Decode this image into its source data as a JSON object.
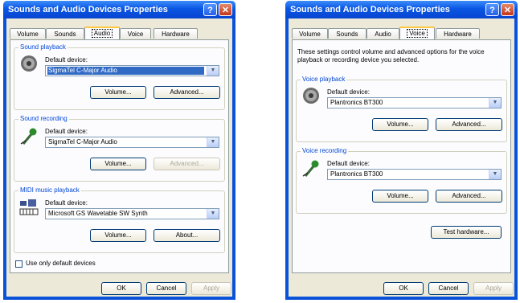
{
  "left_window": {
    "title": "Sounds and Audio Devices Properties",
    "help_glyph": "?",
    "close_glyph": "✕",
    "tabs": [
      {
        "label": "Volume"
      },
      {
        "label": "Sounds"
      },
      {
        "label": "Audio",
        "active": true
      },
      {
        "label": "Voice"
      },
      {
        "label": "Hardware"
      }
    ],
    "sound_playback": {
      "group_label": "Sound playback",
      "default_device_label": "Default device:",
      "device": "SigmaTel C-Major Audio",
      "volume_button": "Volume...",
      "advanced_button": "Advanced..."
    },
    "sound_recording": {
      "group_label": "Sound recording",
      "default_device_label": "Default device:",
      "device": "SigmaTel C-Major Audio",
      "volume_button": "Volume...",
      "advanced_button": "Advanced..."
    },
    "midi_playback": {
      "group_label": "MIDI music playback",
      "default_device_label": "Default device:",
      "device": "Microsoft GS Wavetable SW Synth",
      "volume_button": "Volume...",
      "about_button": "About..."
    },
    "use_default_checkbox": "Use only default devices",
    "ok_button": "OK",
    "cancel_button": "Cancel",
    "apply_button": "Apply"
  },
  "right_window": {
    "title": "Sounds and Audio Devices Properties",
    "help_glyph": "?",
    "close_glyph": "✕",
    "tabs": [
      {
        "label": "Volume"
      },
      {
        "label": "Sounds"
      },
      {
        "label": "Audio"
      },
      {
        "label": "Voice",
        "active": true
      },
      {
        "label": "Hardware"
      }
    ],
    "description": "These settings control volume and advanced options for the voice playback or recording device you selected.",
    "voice_playback": {
      "group_label": "Voice playback",
      "default_device_label": "Default device:",
      "device": "Plantronics BT300",
      "volume_button": "Volume...",
      "advanced_button": "Advanced..."
    },
    "voice_recording": {
      "group_label": "Voice recording",
      "default_device_label": "Default device:",
      "device": "Plantronics BT300",
      "volume_button": "Volume...",
      "advanced_button": "Advanced..."
    },
    "test_hardware_button": "Test hardware...",
    "ok_button": "OK",
    "cancel_button": "Cancel",
    "apply_button": "Apply"
  },
  "combo_arrow_glyph": "▼",
  "colors": {
    "title_blue": "#0A52D8",
    "group_label": "#0046D5",
    "dialog_bg": "#ECE9D8",
    "selection": "#316AC5"
  }
}
